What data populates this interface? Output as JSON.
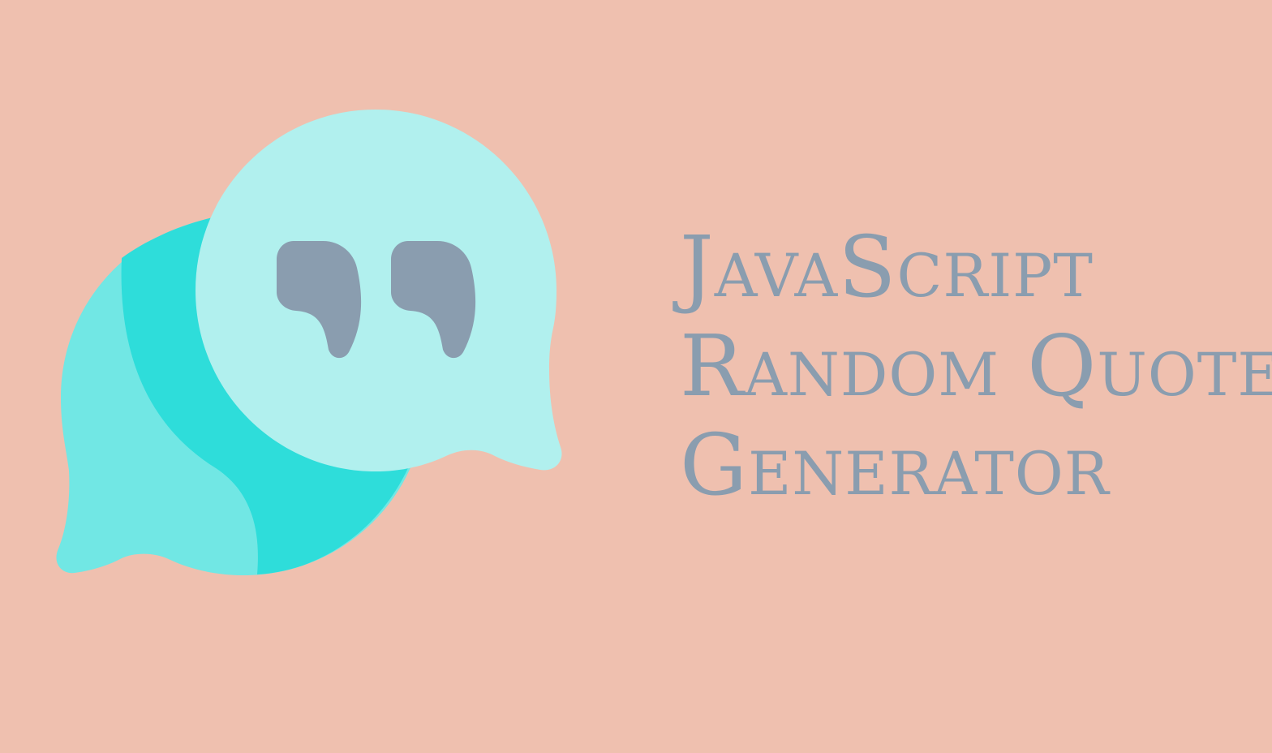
{
  "colors": {
    "background": "#EFC0AF",
    "title_text": "#8A9DAF",
    "bubble_front": "#B1F0EE",
    "bubble_back_light": "#71E7E4",
    "bubble_back_dark": "#2EDDDA",
    "quote_marks": "#8A9DAF"
  },
  "illustration": {
    "icons": [
      "speech-bubble-icon",
      "speech-bubble-icon",
      "quote-marks-icon"
    ]
  },
  "title": {
    "lines": [
      "JavaScript",
      "Random Quote",
      "Generator"
    ]
  }
}
